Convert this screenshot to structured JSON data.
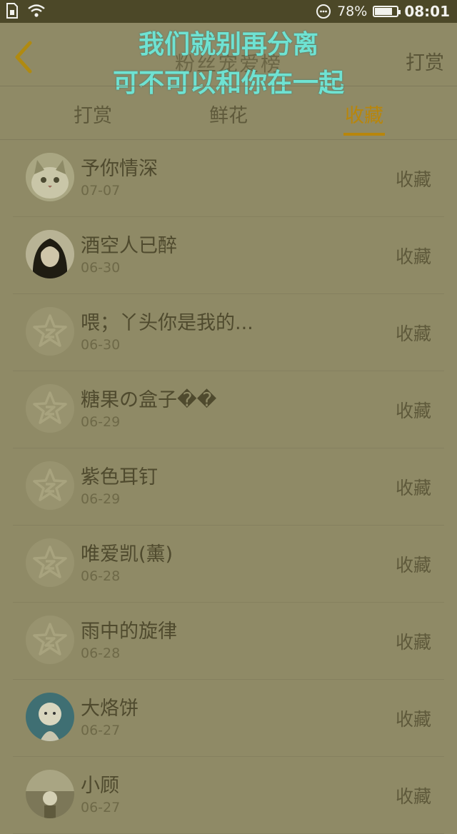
{
  "status_bar": {
    "battery_percent": "78%",
    "battery_level": 0.78,
    "time": "08:01"
  },
  "header": {
    "title": "粉丝宠爱榜",
    "action": "打赏"
  },
  "overlay_lyrics": [
    "我们就别再分离",
    "可不可以和你在一起"
  ],
  "tabs": [
    {
      "label": "打赏",
      "active": false
    },
    {
      "label": "鲜花",
      "active": false
    },
    {
      "label": "收藏",
      "active": true
    }
  ],
  "rows": [
    {
      "name": "予你情深",
      "date": "07-07",
      "action": "收藏",
      "avatar": "cat-avatar"
    },
    {
      "name": "酒空人已醉",
      "date": "06-30",
      "action": "收藏",
      "avatar": "girl-avatar"
    },
    {
      "name": "喂；丫头你是我的...",
      "date": "06-30",
      "action": "收藏",
      "avatar": "default-avatar"
    },
    {
      "name": "糖果の盒子��",
      "date": "06-29",
      "action": "收藏",
      "avatar": "default-avatar"
    },
    {
      "name": "紫色耳钉",
      "date": "06-29",
      "action": "收藏",
      "avatar": "default-avatar"
    },
    {
      "name": "唯爱凯(薰)",
      "date": "06-28",
      "action": "收藏",
      "avatar": "default-avatar"
    },
    {
      "name": "雨中的旋律",
      "date": "06-28",
      "action": "收藏",
      "avatar": "default-avatar"
    },
    {
      "name": "大烙饼",
      "date": "06-27",
      "action": "收藏",
      "avatar": "cartoon-avatar"
    },
    {
      "name": "小顾",
      "date": "06-27",
      "action": "收藏",
      "avatar": "photo-avatar"
    }
  ],
  "colors": {
    "accent": "#b8860b",
    "overlay": "#8f8a66",
    "lyrics": "#6fe2d2"
  }
}
